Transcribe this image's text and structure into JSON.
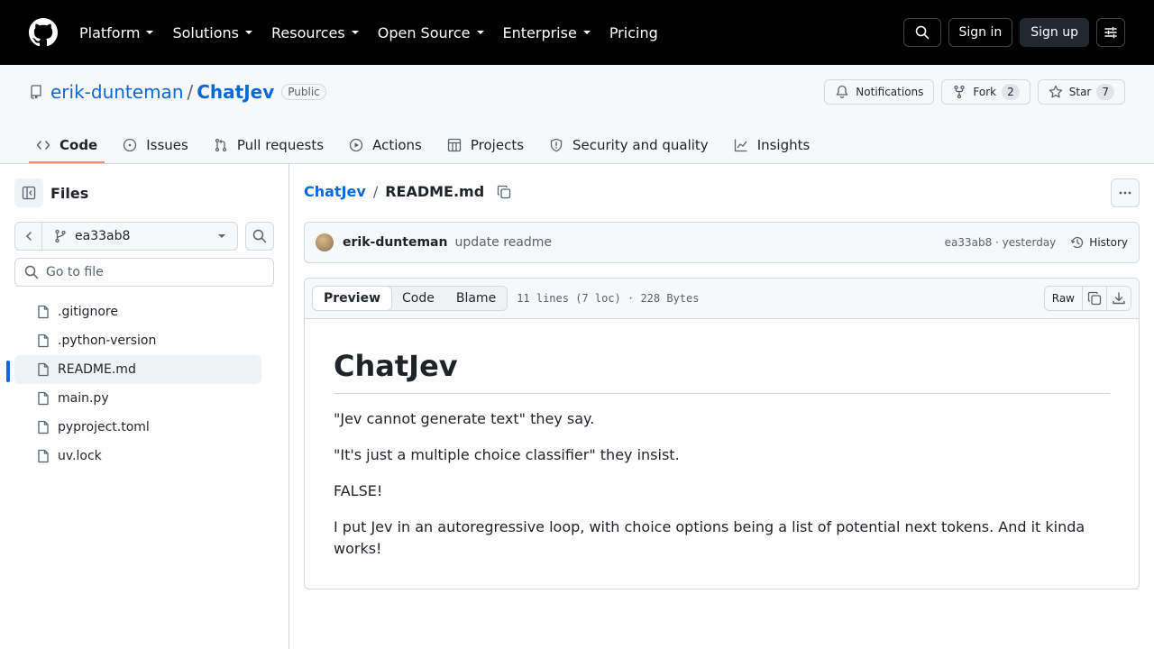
{
  "topnav": {
    "items": [
      {
        "label": "Platform",
        "has_menu": true
      },
      {
        "label": "Solutions",
        "has_menu": true
      },
      {
        "label": "Resources",
        "has_menu": true
      },
      {
        "label": "Open Source",
        "has_menu": true
      },
      {
        "label": "Enterprise",
        "has_menu": true
      },
      {
        "label": "Pricing",
        "has_menu": false
      }
    ],
    "sign_in": "Sign in",
    "sign_up": "Sign up"
  },
  "repo": {
    "owner": "erik-dunteman",
    "separator": "/",
    "name": "ChatJev",
    "visibility": "Public",
    "notifications_label": "Notifications",
    "fork_label": "Fork",
    "fork_count": "2",
    "star_label": "Star",
    "star_count": "7"
  },
  "tabs": [
    {
      "label": "Code",
      "icon": "code-icon",
      "active": true
    },
    {
      "label": "Issues",
      "icon": "issue-icon",
      "active": false
    },
    {
      "label": "Pull requests",
      "icon": "pull-request-icon",
      "active": false
    },
    {
      "label": "Actions",
      "icon": "play-icon",
      "active": false
    },
    {
      "label": "Projects",
      "icon": "table-icon",
      "active": false
    },
    {
      "label": "Security and quality",
      "icon": "shield-icon",
      "active": false
    },
    {
      "label": "Insights",
      "icon": "graph-icon",
      "active": false
    }
  ],
  "sidebar": {
    "title": "Files",
    "branch": "ea33ab8",
    "goto_placeholder": "Go to file",
    "files": [
      {
        "name": ".gitignore",
        "selected": false
      },
      {
        "name": ".python-version",
        "selected": false
      },
      {
        "name": "README.md",
        "selected": true
      },
      {
        "name": "main.py",
        "selected": false
      },
      {
        "name": "pyproject.toml",
        "selected": false
      },
      {
        "name": "uv.lock",
        "selected": false
      }
    ]
  },
  "breadcrumb": {
    "repo": "ChatJev",
    "slash": "/",
    "file": "README.md"
  },
  "commit": {
    "author": "erik-dunteman",
    "message": "update readme",
    "meta": "ea33ab8 · yesterday",
    "history_label": "History"
  },
  "fileview": {
    "tabs": [
      "Preview",
      "Code",
      "Blame"
    ],
    "active_tab": "Preview",
    "meta": "11 lines (7 loc) · 228 Bytes",
    "raw_label": "Raw"
  },
  "readme": {
    "title": "ChatJev",
    "paragraphs": [
      "\"Jev cannot generate text\" they say.",
      "\"It's just a multiple choice classifier\" they insist.",
      "FALSE!",
      "I put Jev in an autoregressive loop, with choice options being a list of potential next tokens. And it kinda works!"
    ]
  },
  "colors": {
    "link": "#0969da",
    "active_tab_underline": "#fd8c73",
    "header_bg": "#000000"
  }
}
